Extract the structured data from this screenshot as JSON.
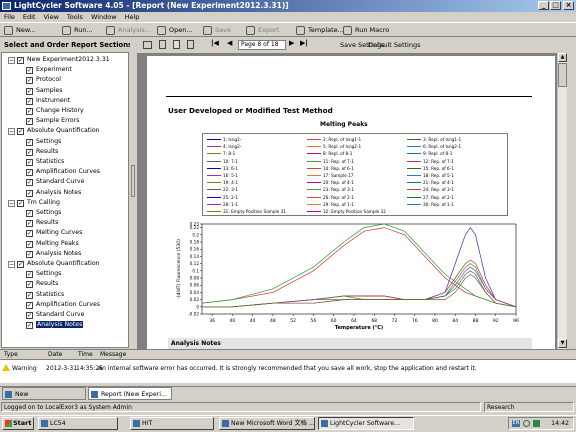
{
  "window": {
    "title": "LightCycler Software 4.05 - [Report (New Experiment2012.3.31)]"
  },
  "menu": [
    "File",
    "Edit",
    "View",
    "Tools",
    "Window",
    "Help"
  ],
  "toolbar": [
    {
      "label": "New...",
      "enabled": true
    },
    {
      "label": "Run...",
      "enabled": true
    },
    {
      "label": "Analysis...",
      "enabled": false
    },
    {
      "label": "Open...",
      "enabled": true
    },
    {
      "label": "Save",
      "enabled": false
    },
    {
      "label": "Export",
      "enabled": false
    },
    {
      "label": "Template...",
      "enabled": true
    },
    {
      "label": "Run Macro",
      "enabled": true
    }
  ],
  "left_panel": {
    "title": "Select and Order Report Sections",
    "tree": [
      {
        "label": "New Experiment2012.3.31",
        "level": 0
      },
      {
        "label": "Experiment",
        "level": 1
      },
      {
        "label": "Protocol",
        "level": 1
      },
      {
        "label": "Samples",
        "level": 1
      },
      {
        "label": "Instrument",
        "level": 1
      },
      {
        "label": "Change History",
        "level": 1
      },
      {
        "label": "Sample Errors",
        "level": 1
      },
      {
        "label": "Absolute Quantification",
        "level": 0
      },
      {
        "label": "Settings",
        "level": 1
      },
      {
        "label": "Results",
        "level": 1
      },
      {
        "label": "Statistics",
        "level": 1
      },
      {
        "label": "Amplification Curves",
        "level": 1
      },
      {
        "label": "Standard Curve",
        "level": 1
      },
      {
        "label": "Analysis Notes",
        "level": 1
      },
      {
        "label": "Tm Calling",
        "level": 0
      },
      {
        "label": "Settings",
        "level": 1
      },
      {
        "label": "Results",
        "level": 1
      },
      {
        "label": "Melting Curves",
        "level": 1
      },
      {
        "label": "Melting Peaks",
        "level": 1
      },
      {
        "label": "Analysis Notes",
        "level": 1
      },
      {
        "label": "Absolute Quantification",
        "level": 0
      },
      {
        "label": "Settings",
        "level": 1
      },
      {
        "label": "Results",
        "level": 1
      },
      {
        "label": "Statistics",
        "level": 1
      },
      {
        "label": "Amplification Curves",
        "level": 1
      },
      {
        "label": "Standard Curve",
        "level": 1
      },
      {
        "label": "Analysis Notes",
        "level": 1,
        "selected": true
      }
    ]
  },
  "report_toolbar": {
    "page": "Page 8 of 18",
    "save_settings": "Save Settings",
    "default_settings": "Default Settings"
  },
  "report": {
    "section_title": "User Developed or Modified Test Method",
    "notes_header": "Analysis Notes"
  },
  "chart_data": {
    "type": "line",
    "title": "Melting Peaks",
    "xlabel": "Temperature (°C)",
    "ylabel": "-(d/dT) Fluorescence (530)",
    "xlim": [
      34,
      96
    ],
    "ylim": [
      -0.02,
      0.23
    ],
    "x_ticks": [
      36,
      40,
      44,
      48,
      52,
      56,
      60,
      64,
      68,
      72,
      76,
      80,
      84,
      88,
      92,
      96
    ],
    "y_ticks": [
      0.23,
      0.22,
      0.2,
      0.18,
      0.16,
      0.14,
      0.12,
      0.1,
      0.08,
      0.06,
      0.04,
      0.02,
      0,
      -0.02
    ],
    "legend": [
      "1: Isng2-",
      "2: Repl. of Isng1-1",
      "3: Repl. of Isng1-1",
      "4: Isng2-",
      "5: Repl. of Isng2-1",
      "6: Repl. of Isng2-1",
      "7: 8-1",
      "8: Repl. of 8-1",
      "9: Repl. of 8-1",
      "10: 7-1",
      "11: Rep. of 7-1",
      "12: Rep. of 7-1",
      "13: 6-1",
      "14: Rep. of 6-1",
      "15: Rep. of 6-1",
      "16: 5-1",
      "17: Sample 17",
      "18: Rep. of 5-1",
      "19: 4-1",
      "20: Rep. of 4-1",
      "21: Rep. of 4-1",
      "22: 3-1",
      "23: Rep. of 3-1",
      "24: Rep. of 3-1",
      "25: 2-1",
      "26: Rep. of 2-1",
      "27: Rep. of 2-1",
      "28: 1-1",
      "29: Rep. of 1-1",
      "30: Rep. of 1-1",
      "31: Empty Position Sample 31",
      "32: Empty Position Sample 32"
    ],
    "series": [
      {
        "x": [
          34,
          40,
          48,
          56,
          62,
          66,
          70,
          74,
          78,
          82,
          86,
          88,
          90,
          92,
          96
        ],
        "values": [
          0.01,
          0.02,
          0.04,
          0.1,
          0.17,
          0.21,
          0.22,
          0.2,
          0.14,
          0.08,
          0.04,
          0.03,
          0.02,
          0.01,
          0.0
        ],
        "color": "#e03030"
      },
      {
        "x": [
          34,
          40,
          48,
          56,
          62,
          66,
          70,
          74,
          78,
          82,
          86,
          88,
          90,
          92,
          96
        ],
        "values": [
          0.01,
          0.02,
          0.05,
          0.11,
          0.18,
          0.22,
          0.23,
          0.21,
          0.15,
          0.09,
          0.05,
          0.03,
          0.02,
          0.01,
          0.0
        ],
        "color": "#20a040"
      },
      {
        "x": [
          34,
          40,
          48,
          56,
          62,
          66,
          70,
          74,
          78,
          82,
          84,
          86,
          87,
          88,
          90,
          92,
          96
        ],
        "values": [
          0.0,
          0.0,
          0.01,
          0.02,
          0.03,
          0.03,
          0.03,
          0.02,
          0.02,
          0.04,
          0.12,
          0.2,
          0.22,
          0.2,
          0.08,
          0.02,
          0.0
        ],
        "color": "#3030c0"
      },
      {
        "x": [
          34,
          40,
          48,
          56,
          62,
          66,
          70,
          74,
          78,
          82,
          84,
          86,
          87,
          88,
          90,
          92,
          96
        ],
        "values": [
          0.0,
          0.0,
          0.01,
          0.02,
          0.03,
          0.03,
          0.03,
          0.02,
          0.02,
          0.04,
          0.08,
          0.12,
          0.13,
          0.12,
          0.06,
          0.02,
          0.0
        ],
        "color": "#c03030"
      },
      {
        "x": [
          34,
          40,
          48,
          56,
          62,
          66,
          70,
          74,
          78,
          82,
          84,
          86,
          87,
          88,
          90,
          92,
          96
        ],
        "values": [
          0.0,
          0.0,
          0.01,
          0.02,
          0.03,
          0.02,
          0.02,
          0.02,
          0.02,
          0.03,
          0.07,
          0.11,
          0.12,
          0.11,
          0.05,
          0.02,
          0.0
        ],
        "color": "#30a030"
      },
      {
        "x": [
          34,
          40,
          48,
          56,
          62,
          66,
          70,
          74,
          78,
          82,
          84,
          86,
          87,
          88,
          90,
          92,
          96
        ],
        "values": [
          0.0,
          0.0,
          0.01,
          0.02,
          0.02,
          0.02,
          0.02,
          0.02,
          0.02,
          0.03,
          0.06,
          0.1,
          0.11,
          0.1,
          0.05,
          0.02,
          0.0
        ],
        "color": "#a040a0"
      },
      {
        "x": [
          34,
          40,
          48,
          56,
          62,
          66,
          70,
          74,
          78,
          82,
          84,
          86,
          87,
          88,
          90,
          92,
          96
        ],
        "values": [
          0.0,
          0.0,
          0.01,
          0.01,
          0.02,
          0.02,
          0.02,
          0.02,
          0.02,
          0.03,
          0.05,
          0.09,
          0.1,
          0.09,
          0.04,
          0.01,
          0.0
        ],
        "color": "#208080"
      },
      {
        "x": [
          34,
          40,
          48,
          56,
          62,
          66,
          70,
          74,
          78,
          82,
          84,
          86,
          87,
          88,
          90,
          92,
          96
        ],
        "values": [
          0.0,
          0.0,
          0.01,
          0.01,
          0.02,
          0.02,
          0.02,
          0.02,
          0.02,
          0.02,
          0.04,
          0.08,
          0.09,
          0.08,
          0.04,
          0.01,
          0.0
        ],
        "color": "#806020"
      }
    ]
  },
  "log": {
    "headers": [
      "Type",
      "Date",
      "Time",
      "Message"
    ],
    "row": {
      "type": "Warning",
      "date": "2012-3-31",
      "time": "14:35:25",
      "message": "An internal software error has occurred. It is strongly recommended that you save all work, stop the application and restart it."
    }
  },
  "doc_tabs": [
    {
      "label": "New Experiment2012.3...",
      "active": false
    },
    {
      "label": "Report (New Experi...",
      "active": true
    }
  ],
  "status": {
    "left": "Logged on to LocalExor3 as System Admin",
    "right": "Research"
  },
  "taskbar": {
    "start": "Start",
    "tasks": [
      "LC54",
      "HIT",
      "New Microsoft Word 文档 ...",
      "LightCycler Software..."
    ],
    "clock": "14:42",
    "lang": "EN"
  },
  "colors": {
    "title_bar": "#0a246a",
    "selection": "#0a246a",
    "report_bg": "#808080"
  }
}
